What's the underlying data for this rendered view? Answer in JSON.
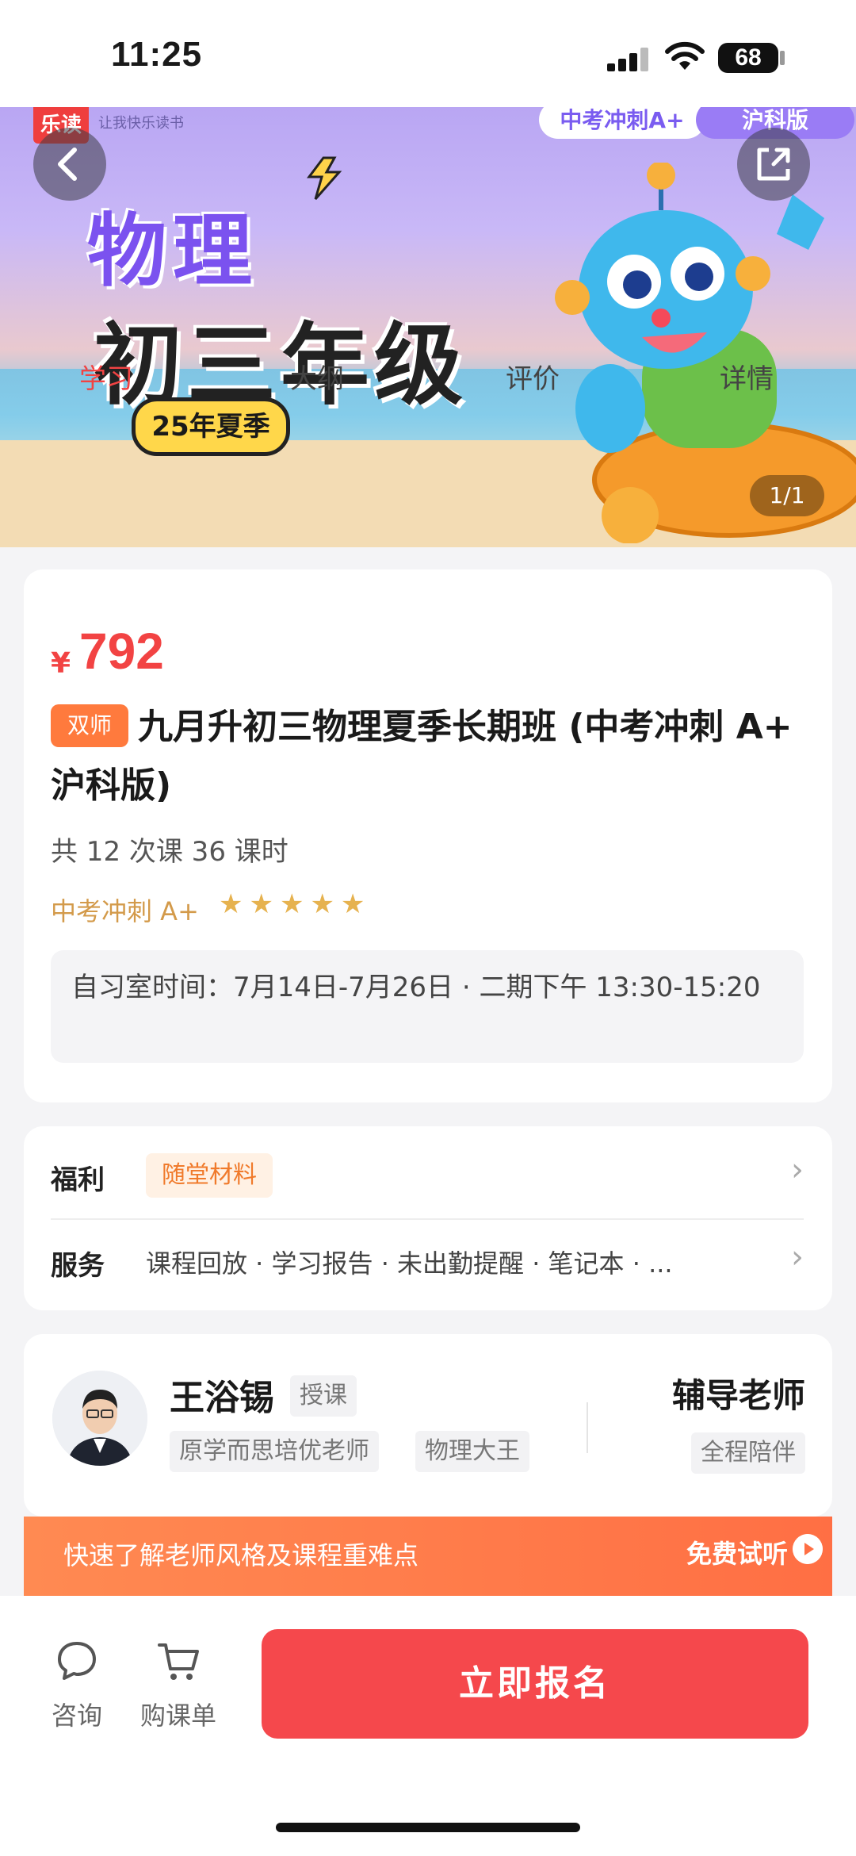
{
  "status_bar": {
    "time": "11:25",
    "battery": "68"
  },
  "banner": {
    "logo": "乐读",
    "slogan": "让我快乐读书",
    "tag_left": "中考冲刺A+",
    "tag_right": "沪科版",
    "subject": "物理",
    "grade": "初三年级",
    "season": "25年夏季",
    "pager": "1/1"
  },
  "tabs": [
    {
      "label": "学习"
    },
    {
      "label": "大纲"
    },
    {
      "label": "评价"
    },
    {
      "label": "详情"
    }
  ],
  "course": {
    "currency": "¥",
    "price": "792",
    "badge": "双师",
    "title": "九月升初三物理夏季长期班 (中考冲刺 A+ 沪科版)",
    "lessons": "共 12 次课 36 课时",
    "level": "中考冲刺 A+",
    "stars": "★★★★★",
    "rating": 5,
    "study_time": "自习室时间：7月14日-7月26日 · 二期下午 13:30-15:20"
  },
  "perks": {
    "welfare_label": "福利",
    "welfare_tag": "随堂材料",
    "service_label": "服务",
    "service_text": "课程回放 · 学习报告 · 未出勤提醒 · 笔记本 · ..."
  },
  "teacher": {
    "name": "王浴锡",
    "role_tag": "授课",
    "tags": [
      "原学而思培优老师",
      "物理大王"
    ],
    "tutor_title": "辅导老师",
    "tutor_tag": "全程陪伴"
  },
  "promo": {
    "text": "快速了解老师风格及课程重难点",
    "cta": "免费试听"
  },
  "bottom_bar": {
    "consult_label": "咨询",
    "cart_label": "购课单",
    "enroll_label": "立即报名"
  },
  "colors": {
    "accent": "#f24343",
    "orange": "#ff7a3d",
    "gold": "#d39a4a"
  }
}
